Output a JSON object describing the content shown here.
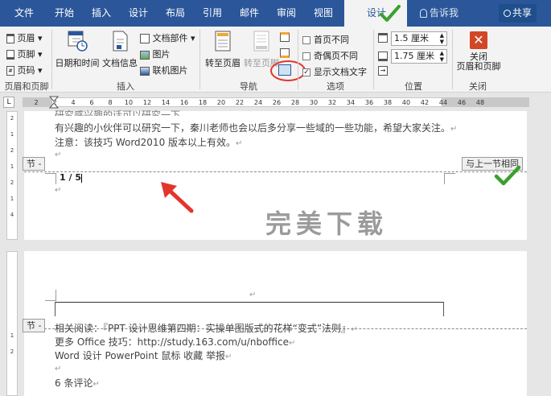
{
  "tabs": {
    "file": "文件",
    "home": "开始",
    "insert": "插入",
    "design": "设计",
    "layout": "布局",
    "references": "引用",
    "mailings": "邮件",
    "review": "审阅",
    "view": "视图",
    "design_active": "设计"
  },
  "tell_me": "告诉我",
  "share": "共享",
  "ribbon": {
    "hf_group": {
      "header": "页眉",
      "footer": "页脚",
      "page_number": "页码",
      "label": "页眉和页脚"
    },
    "insert_group": {
      "datetime": "日期和时间",
      "docinfo": "文档信息",
      "quickparts": "文档部件",
      "picture": "图片",
      "online_picture": "联机图片",
      "label": "插入"
    },
    "nav_group": {
      "goto_header": "转至页眉",
      "goto_footer": "转至页脚",
      "label": "导航"
    },
    "options_group": {
      "first_page": "首页不同",
      "odd_even": "奇偶页不同",
      "show_text": "显示文档文字",
      "label": "选项"
    },
    "position_group": {
      "header_pos": "1.5 厘米",
      "footer_pos": "1.75 厘米",
      "label": "位置"
    },
    "close_group": {
      "close_line1": "关闭",
      "close_line2": "页眉和页脚",
      "label": "关闭"
    }
  },
  "ruler": {
    "corner": "L",
    "ticks": [
      "2",
      "2",
      "4",
      "6",
      "8",
      "10",
      "12",
      "14",
      "16",
      "18",
      "20",
      "22",
      "24",
      "26",
      "28",
      "30",
      "32",
      "34",
      "36",
      "38",
      "40",
      "42",
      "44",
      "46",
      "48"
    ]
  },
  "vruler": {
    "page1_ticks": [
      "2",
      "1",
      "2",
      "1",
      "2",
      "1",
      "4"
    ],
    "page2_ticks": [
      "1",
      "2"
    ]
  },
  "page1": {
    "line0": "研究感兴趣的话可以研究一下。",
    "line1": "有兴趣的小伙伴可以研究一下，秦川老师也会以后多分享一些域的一些功能，希望大家关注。",
    "line2": "注意：该技巧 Word2010 版本以上有效。",
    "section_tag": "节 -",
    "same_as_prev": "与上一节相同",
    "page_field": "1 / 5"
  },
  "page2": {
    "section_tag": "节 -",
    "line1": "相关阅读：『PPT 设计思维第四期：实操单图版式的花样“变式”法则』",
    "line2": "更多 Office 技巧：http://study.163.com/u/nboffice",
    "line3": " Word  设计  PowerPoint  鼠标  收藏    举报",
    "line4": "6  条评论"
  },
  "para_mark": "↵",
  "watermark": "完美下载",
  "colors": {
    "ribbon_blue": "#2b579a",
    "annotation_green": "#3aa02e",
    "annotation_red": "#e2362d",
    "close_red": "#d24726"
  }
}
